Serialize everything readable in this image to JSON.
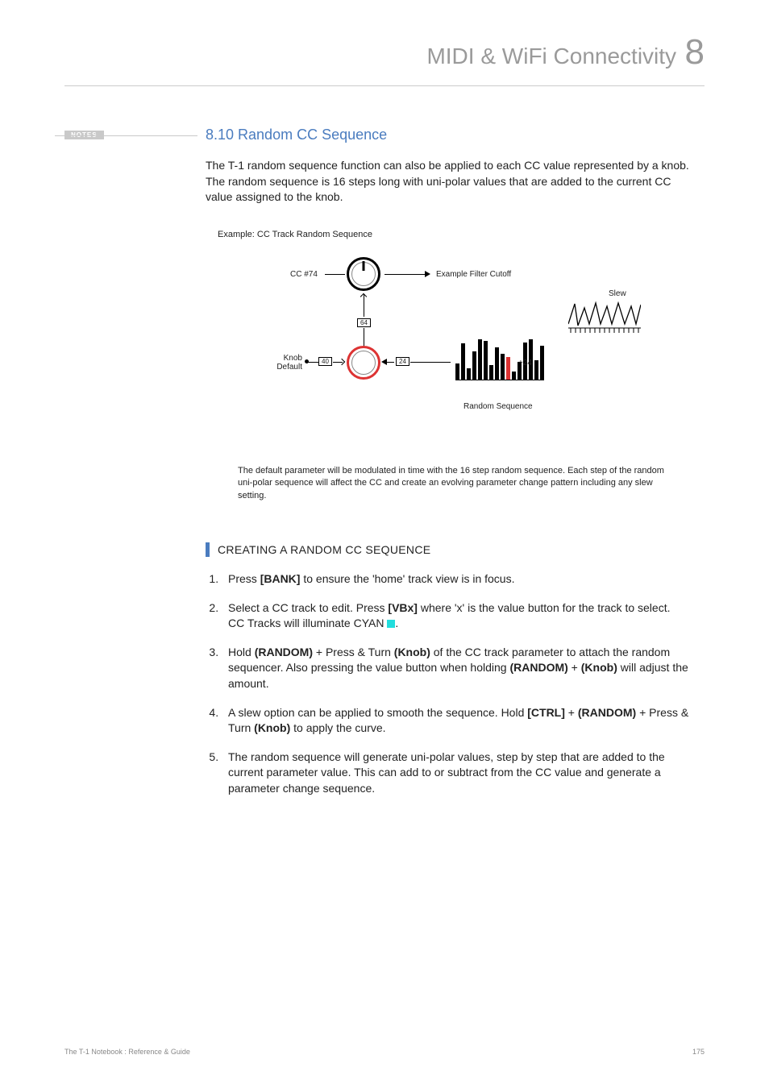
{
  "header": {
    "chapter_title": "MIDI & WiFi Connectivity",
    "chapter_number": "8"
  },
  "sidebar": {
    "notes_label": "NOTES"
  },
  "section": {
    "number_title": "8.10 Random CC Sequence",
    "intro": "The T-1 random sequence function can also be applied to each CC value represented by a knob. The random sequence is 16 steps long with uni-polar values that are added to the current CC value assigned to the knob.",
    "example_label": "Example: CC Track Random Sequence",
    "diagram": {
      "cc_label": "CC #74",
      "example_destination": "Example Filter Cutoff",
      "slew_label": "Slew",
      "knob_default_label": "Knob\nDefault",
      "value_top": "64",
      "value_left": "40",
      "value_right": "24",
      "random_offset": "+24",
      "random_sequence_label": "Random Sequence"
    },
    "explanation": "The default parameter will be modulated in time with the 16 step random sequence. Each step of the random uni-polar sequence will affect the CC and create an evolving parameter change pattern including any slew setting.",
    "sub_heading": "CREATING A RANDOM CC SEQUENCE",
    "steps": [
      {
        "pre": "Press ",
        "b1": "[BANK]",
        "post1": " to ensure the 'home' track view is in focus."
      },
      {
        "pre": "Select a CC track to edit. Press ",
        "b1": "[VBx]",
        "post1": " where 'x' is the value button for the track to select. CC Tracks will illuminate CYAN "
      },
      {
        "pre": "Hold ",
        "b1": "(RANDOM)",
        "mid1": " + Press & Turn ",
        "b2": "(Knob)",
        "post1": " of the CC track parameter to attach the random sequencer. Also pressing the value button when holding ",
        "b3": "(RANDOM)",
        "mid2": " + ",
        "b4": "(Knob)",
        "post2": " will adjust the amount."
      },
      {
        "pre": "A slew option can be applied to smooth the sequence. Hold ",
        "b1": "[CTRL]",
        "mid1": " + ",
        "b2": "(RANDOM)",
        "mid2": " + Press & Turn ",
        "b3": "(Knob)",
        "post1": " to apply the curve."
      },
      {
        "pre": "The random sequence will generate uni-polar values, step by step that are added to the current parameter value. This can add to or subtract from the CC value and generate a parameter change sequence."
      }
    ]
  },
  "footer": {
    "left": "The T-1 Notebook : Reference & Guide",
    "page": "175"
  }
}
